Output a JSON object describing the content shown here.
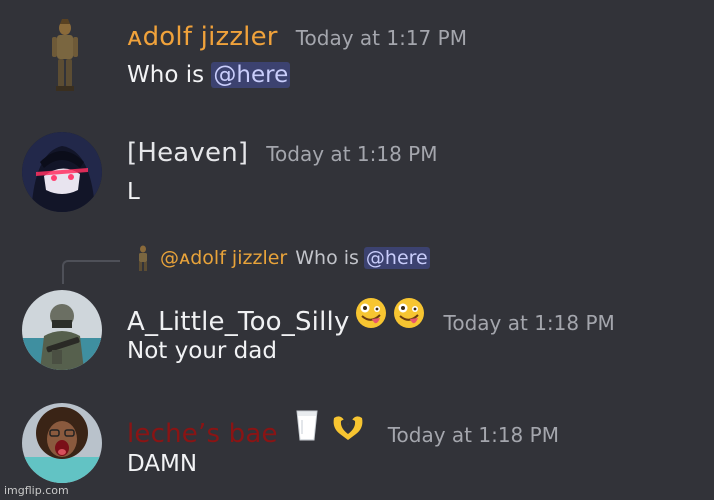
{
  "messages": [
    {
      "username": "ᴀdolf jizzler",
      "username_color": "#f0a23b",
      "timestamp": "Today at 1:17 PM",
      "content_prefix": "Who is ",
      "mention": "@here"
    },
    {
      "username": "[Heaven]",
      "username_color": "#e6e7ea",
      "timestamp": "Today at 1:18 PM",
      "content": "L"
    },
    {
      "reply": {
        "username": "@ᴀdolf jizzler",
        "content_prefix": "Who is ",
        "mention": "@here"
      },
      "username": "A_Little_Too_Silly",
      "username_color": "#f0f1f3",
      "timestamp": "Today at 1:18 PM",
      "content": "Not your dad",
      "emojis": [
        "zany-face-emoji",
        "zany-face-emoji"
      ]
    },
    {
      "username": "leche’s bae",
      "username_color": "#8a1414",
      "timestamp": "Today at 1:18 PM",
      "content": "DAMN",
      "emojis": [
        "milk-glass-emoji",
        "heart-hands-emoji"
      ]
    }
  ],
  "watermark": "imgflip.com",
  "colors": {
    "background": "#323339",
    "timestamp": "#a4a6ad",
    "mention_bg": "#3c4270",
    "mention_text": "#c9cdfb"
  }
}
